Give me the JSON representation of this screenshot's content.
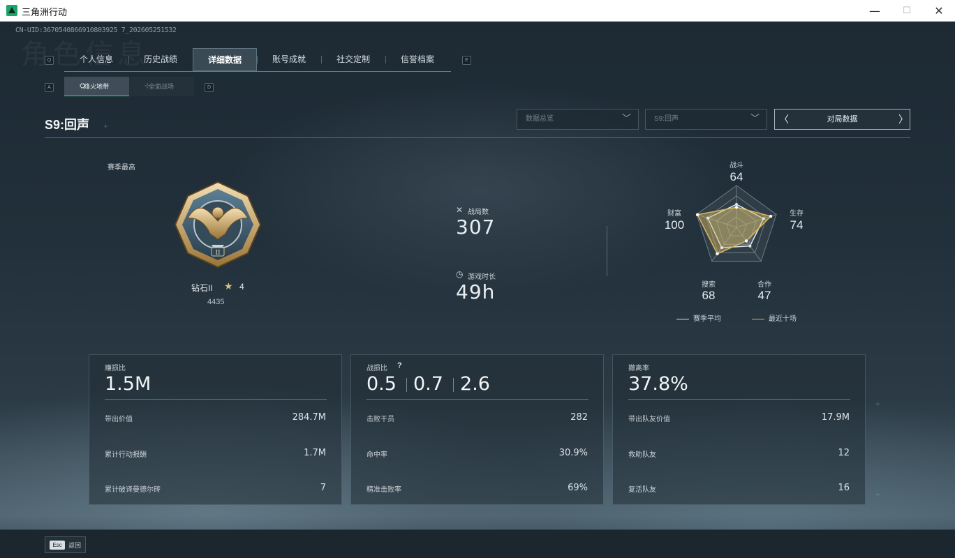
{
  "window": {
    "title": "三角洲行动",
    "minimize": "—",
    "maximize": "☐",
    "close": "✕"
  },
  "uid": "CN-UID:3670540866910803925 7_202605251532",
  "ghost_title": "角色信息",
  "key_hints": {
    "prev_tab": "Q",
    "next_tab": "E",
    "prev_sub": "A",
    "next_sub": "D"
  },
  "tabs": [
    {
      "label": "个人信息"
    },
    {
      "label": "历史战绩"
    },
    {
      "label": "详细数据",
      "active": true
    },
    {
      "label": "账号成就"
    },
    {
      "label": "社交定制"
    },
    {
      "label": "信誉档案"
    }
  ],
  "subtabs": {
    "active": "烽火地带",
    "inactive": "全面战场",
    "active_icon": "⛭",
    "inactive_icon": "⊹"
  },
  "season_title": "S9:回声",
  "dropdowns": {
    "overview": "数据总览",
    "season": "S9:回声"
  },
  "pager": {
    "label": "对局数据",
    "prev": "〈",
    "next": "〉"
  },
  "rank": {
    "heading": "赛季最高",
    "name": "钻石II",
    "star_icon": "★",
    "stars": "4",
    "points": "4435",
    "tier_numeral": "II"
  },
  "stats": {
    "matches_label": "战局数",
    "matches_value": "307",
    "matches_icon": "✕",
    "playtime_label": "游戏时长",
    "playtime_value": "49h",
    "playtime_icon": "◷"
  },
  "radar": {
    "axes": [
      {
        "name": "战斗",
        "value": "64"
      },
      {
        "name": "生存",
        "value": "74"
      },
      {
        "name": "合作",
        "value": "47"
      },
      {
        "name": "搜索",
        "value": "68"
      },
      {
        "name": "财富",
        "value": "100"
      }
    ],
    "season_avg": [
      0.55,
      0.68,
      0.55,
      0.6,
      0.72
    ],
    "recent_ten": [
      0.48,
      0.86,
      0.4,
      0.78,
      0.98
    ],
    "legend_avg": "赛季平均",
    "legend_recent": "最近十场",
    "colors": {
      "avg": "#e3e8eb",
      "recent": "#d8b860"
    }
  },
  "cards": {
    "profit": {
      "label": "赚损比",
      "value": "1.5M",
      "rows": [
        {
          "label": "带出价值",
          "value": "284.7M"
        },
        {
          "label": "累计行动报酬",
          "value": "1.7M"
        },
        {
          "label": "累计破译曼德尔砖",
          "value": "7"
        }
      ]
    },
    "combat": {
      "label": "战损比",
      "help": "?",
      "ratios": [
        "0.5",
        "0.7",
        "2.6"
      ],
      "rows": [
        {
          "label": "击败干员",
          "value": "282"
        },
        {
          "label": "命中率",
          "value": "30.9%"
        },
        {
          "label": "精准击败率",
          "value": "69%"
        }
      ]
    },
    "extract": {
      "label": "撤离率",
      "value": "37.8%",
      "rows": [
        {
          "label": "带出队友价值",
          "value": "17.9M"
        },
        {
          "label": "救助队友",
          "value": "12"
        },
        {
          "label": "复活队友",
          "value": "16"
        }
      ]
    }
  },
  "footer": {
    "esc_key": "Esc",
    "esc_label": "返回"
  }
}
